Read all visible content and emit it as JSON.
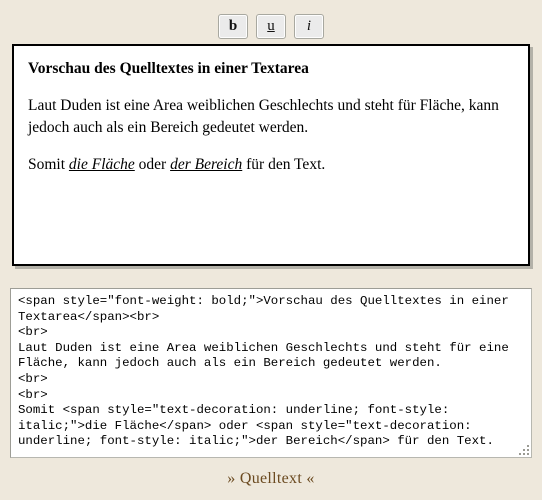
{
  "toolbar": {
    "buttons": [
      {
        "name": "bold-button",
        "label": "b"
      },
      {
        "name": "underline-button",
        "label": "u"
      },
      {
        "name": "italic-button",
        "label": "i"
      }
    ]
  },
  "preview": {
    "heading": "Vorschau des Quelltextes in einer Textarea",
    "paragraph": "Laut Duden ist eine Area weiblichen Geschlechts und steht für Fläche, kann jedoch auch als ein Bereich gedeutet werden.",
    "closing": {
      "lead": "Somit ",
      "em1": "die Fläche",
      "mid": " oder ",
      "em2": "der Bereich",
      "tail": " für den Text."
    }
  },
  "source": {
    "value": "<span style=\"font-weight: bold;\">Vorschau des Quelltextes in einer Textarea</span><br>\n<br>\nLaut Duden ist eine Area weiblichen Geschlechts und steht für eine Fläche, kann jedoch auch als ein Bereich gedeutet werden.\n<br>\n<br>\nSomit <span style=\"text-decoration: underline; font-style: italic;\">die Fläche</span> oder <span style=\"text-decoration: underline; font-style: italic;\">der Bereich</span> für den Text."
  },
  "footer": {
    "label": "» Quelltext «"
  },
  "colors": {
    "page_background": "#eee8dc",
    "pane_background": "#ffffff",
    "pane_border": "#000000",
    "pane_shadow": "#b3b1a8",
    "textarea_border": "#b7b7b0",
    "footer_text": "#6b4a20",
    "button_face": "#ebebeb"
  }
}
